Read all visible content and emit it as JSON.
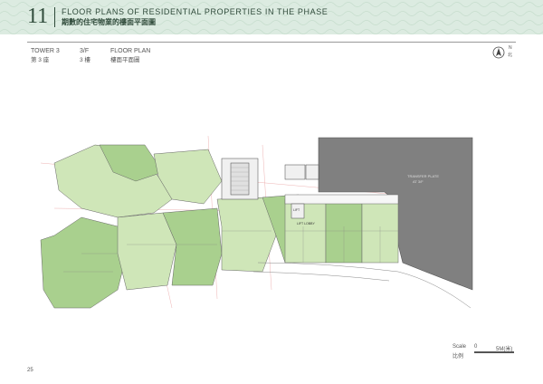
{
  "header": {
    "section_number": "11",
    "title_en": "FLOOR PLANS OF RESIDENTIAL PROPERTIES IN THE PHASE",
    "title_zh": "期數的住宅物業的樓面平面圖"
  },
  "info": {
    "tower_en": "TOWER 3",
    "tower_zh": "第 3 座",
    "floor_en": "3/F",
    "floor_zh": "3 樓",
    "plan_en": "FLOOR PLAN",
    "plan_zh": "樓面平面圖"
  },
  "north": {
    "en": "N",
    "zh": "北"
  },
  "scale": {
    "label_en": "Scale",
    "label_zh": "比例",
    "start": "0",
    "end": "5M(米)"
  },
  "plan_labels": {
    "transfer_plate": "TRANSFER PLATE",
    "transfer_plate_level": "AT 3/F",
    "lift_lobby": "LIFT LOBBY",
    "lift": "LIFT"
  },
  "page_number": "25",
  "colors": {
    "header_band": "#dcebe1",
    "unit_green": "#a9d08e",
    "unit_green_light": "#cfe6b8",
    "transfer_plate_grey": "#808080",
    "dimension_red": "#d9534f"
  }
}
